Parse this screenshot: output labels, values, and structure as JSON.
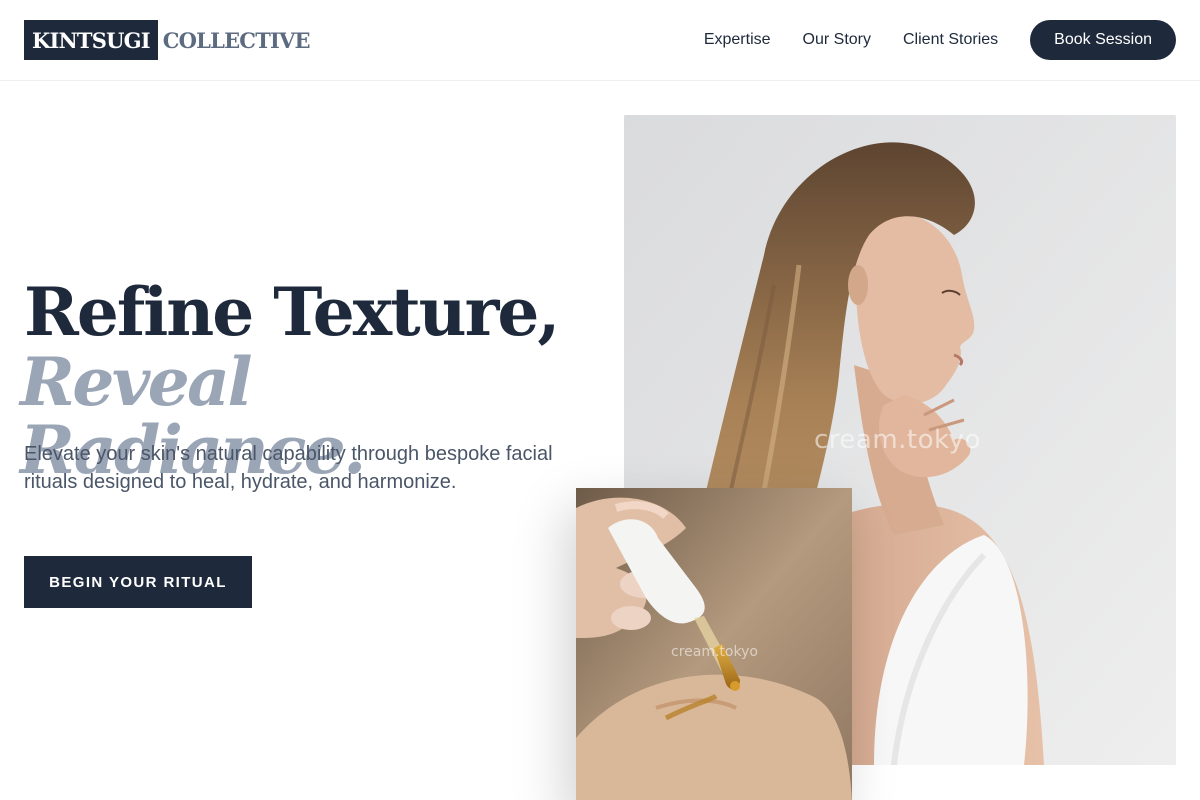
{
  "header": {
    "logo_box": "KINTSUGI",
    "logo_rest": "COLLECTIVE",
    "nav": [
      "Expertise",
      "Our Story",
      "Client Stories"
    ],
    "cta": "Book Session"
  },
  "hero": {
    "headline_line1": "Refine Texture,",
    "headline_line2": "Reveal Radiance.",
    "subtext": "Elevate your skin's natural capability through bespoke facial rituals designed to heal, hydrate, and harmonize.",
    "cta": "BEGIN YOUR RITUAL"
  },
  "images": {
    "main_watermark": "cream.tokyo",
    "inset_watermark": "cream.tokyo"
  },
  "colors": {
    "navy": "#1e2a3b",
    "slate": "#9aa5b6",
    "body_text": "#4a5668"
  }
}
